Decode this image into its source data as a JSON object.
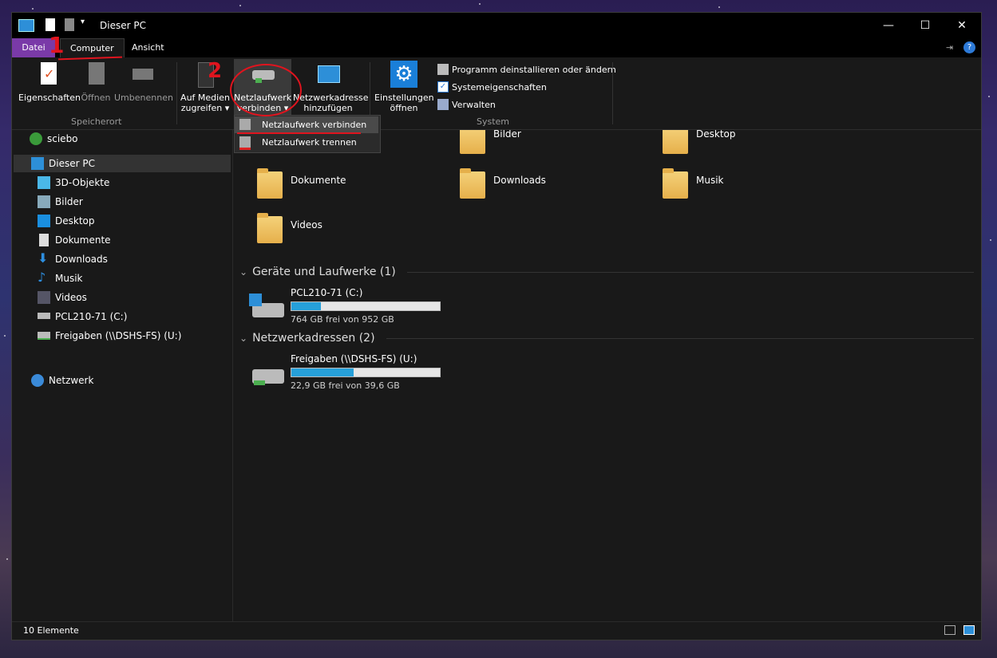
{
  "window": {
    "title": "Dieser PC"
  },
  "tabs": [
    {
      "label": "Datei"
    },
    {
      "label": "Computer"
    },
    {
      "label": "Ansicht"
    }
  ],
  "ribbon": {
    "location": {
      "group_label": "Speicherort",
      "items": [
        {
          "label": "Eigenschaften"
        },
        {
          "label": "Öffnen"
        },
        {
          "label": "Umbenennen"
        }
      ]
    },
    "network": {
      "items": [
        {
          "line1": "Auf Medien",
          "line2": "zugreifen ▾"
        },
        {
          "line1": "Netzlaufwerk",
          "line2": "verbinden ▾"
        },
        {
          "line1": "Netzwerkadresse",
          "line2": "hinzufügen"
        }
      ]
    },
    "system": {
      "group_label": "System",
      "settings_line1": "Einstellungen",
      "settings_line2": "öffnen",
      "items": [
        {
          "label": "Programm deinstallieren oder ändern"
        },
        {
          "label": "Systemeigenschaften"
        },
        {
          "label": "Verwalten"
        }
      ]
    }
  },
  "dropdown": {
    "items": [
      {
        "label": "Netzlaufwerk verbinden"
      },
      {
        "label": "Netzlaufwerk trennen"
      }
    ]
  },
  "sidebar": {
    "items": [
      {
        "label": "sciebo"
      },
      {
        "label": "Dieser PC"
      },
      {
        "label": "3D-Objekte"
      },
      {
        "label": "Bilder"
      },
      {
        "label": "Desktop"
      },
      {
        "label": "Dokumente"
      },
      {
        "label": "Downloads"
      },
      {
        "label": "Musik"
      },
      {
        "label": "Videos"
      },
      {
        "label": "PCL210-71 (C:)"
      },
      {
        "label": "Freigaben (\\\\DSHS-FS) (U:)"
      },
      {
        "label": "Netzwerk"
      }
    ]
  },
  "folders": [
    {
      "label": "Bilder"
    },
    {
      "label": "Desktop"
    },
    {
      "label": "Dokumente"
    },
    {
      "label": "Downloads"
    },
    {
      "label": "Musik"
    },
    {
      "label": "Videos"
    }
  ],
  "sections": {
    "devices": "Geräte und Laufwerke (1)",
    "network": "Netzwerkadressen (2)"
  },
  "drives": [
    {
      "name": "PCL210-71 (C:)",
      "space": "764 GB frei von 952 GB",
      "used_fraction": 0.2
    },
    {
      "name": "Freigaben (\\\\DSHS-FS) (U:)",
      "space": "22,9 GB frei von 39,6 GB",
      "used_fraction": 0.42
    }
  ],
  "annotations": {
    "num1": "1",
    "num2": "2"
  },
  "status": {
    "count": "10 Elemente"
  },
  "colors": {
    "accent": "#26a0da",
    "file_tab": "#7a3aa8",
    "annotation": "#e0141e"
  }
}
